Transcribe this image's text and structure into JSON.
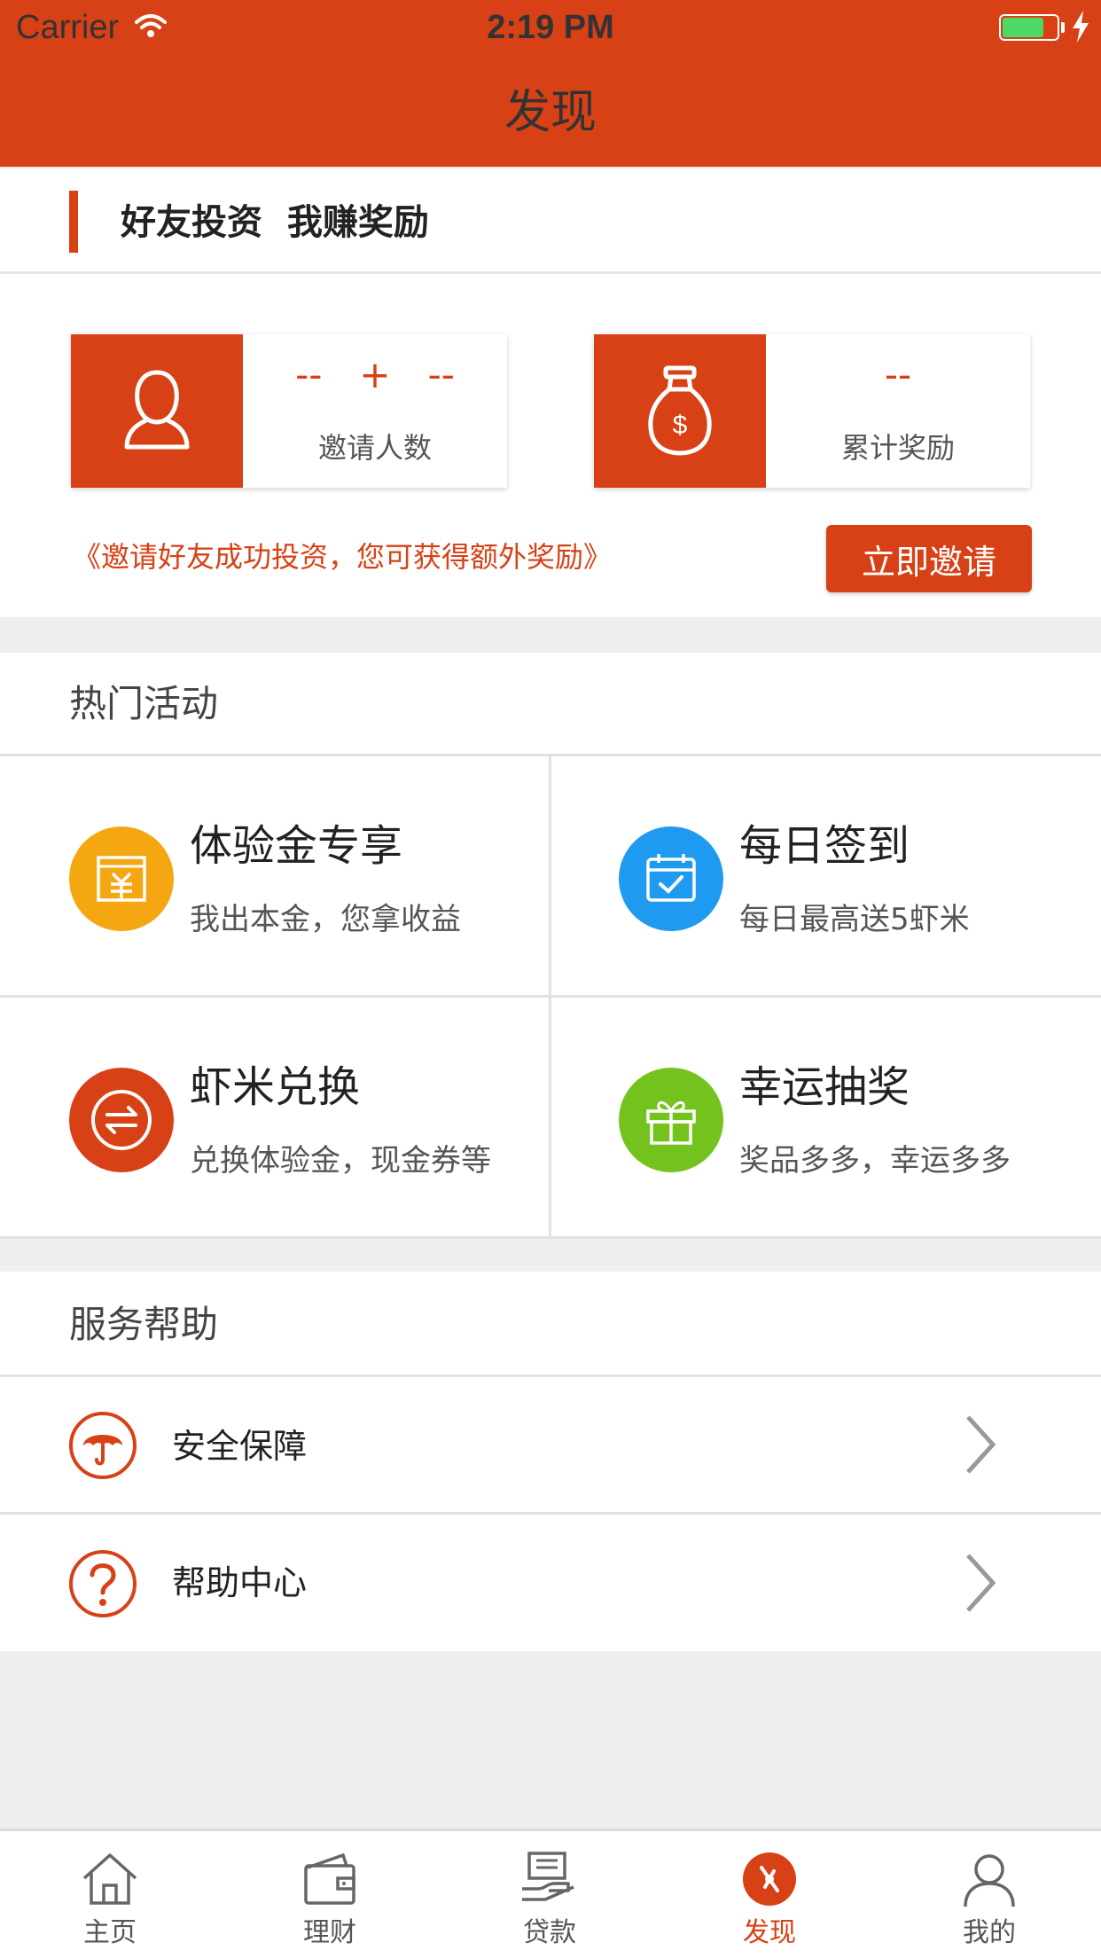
{
  "status_bar": {
    "carrier": "Carrier",
    "time": "2:19 PM"
  },
  "nav": {
    "title": "发现"
  },
  "invite": {
    "title": "好友投资  我赚奖励",
    "invite_count": {
      "left": "--",
      "plus": "+",
      "right": "--",
      "label": "邀请人数"
    },
    "total_reward": {
      "value": "--",
      "label": "累计奖励"
    },
    "hint": "《邀请好友成功投资，您可获得额外奖励》",
    "button_label": "立即邀请"
  },
  "hot": {
    "heading": "热门活动",
    "items": [
      {
        "title": "体验金专享",
        "subtitle": "我出本金，您拿收益",
        "icon": "voucher-icon",
        "color": "#f5a712"
      },
      {
        "title": "每日签到",
        "subtitle": "每日最高送5虾米",
        "icon": "calendar-check-icon",
        "color": "#1e9bf0"
      },
      {
        "title": "虾米兑换",
        "subtitle": "兑换体验金，现金券等",
        "icon": "exchange-icon",
        "color": "#d84115"
      },
      {
        "title": "幸运抽奖",
        "subtitle": "奖品多多，幸运多多",
        "icon": "gift-icon",
        "color": "#74c21e"
      }
    ]
  },
  "help": {
    "heading": "服务帮助",
    "items": [
      {
        "label": "安全保障",
        "icon": "umbrella-icon"
      },
      {
        "label": "帮助中心",
        "icon": "question-icon"
      }
    ]
  },
  "tabs": [
    {
      "label": "主页",
      "icon": "home-icon"
    },
    {
      "label": "理财",
      "icon": "wallet-icon"
    },
    {
      "label": "贷款",
      "icon": "loan-icon"
    },
    {
      "label": "发现",
      "icon": "compass-icon",
      "active": true
    },
    {
      "label": "我的",
      "icon": "user-icon"
    }
  ],
  "colors": {
    "brand": "#d84115",
    "tab_active": "#d84115",
    "background": "#efefef"
  }
}
